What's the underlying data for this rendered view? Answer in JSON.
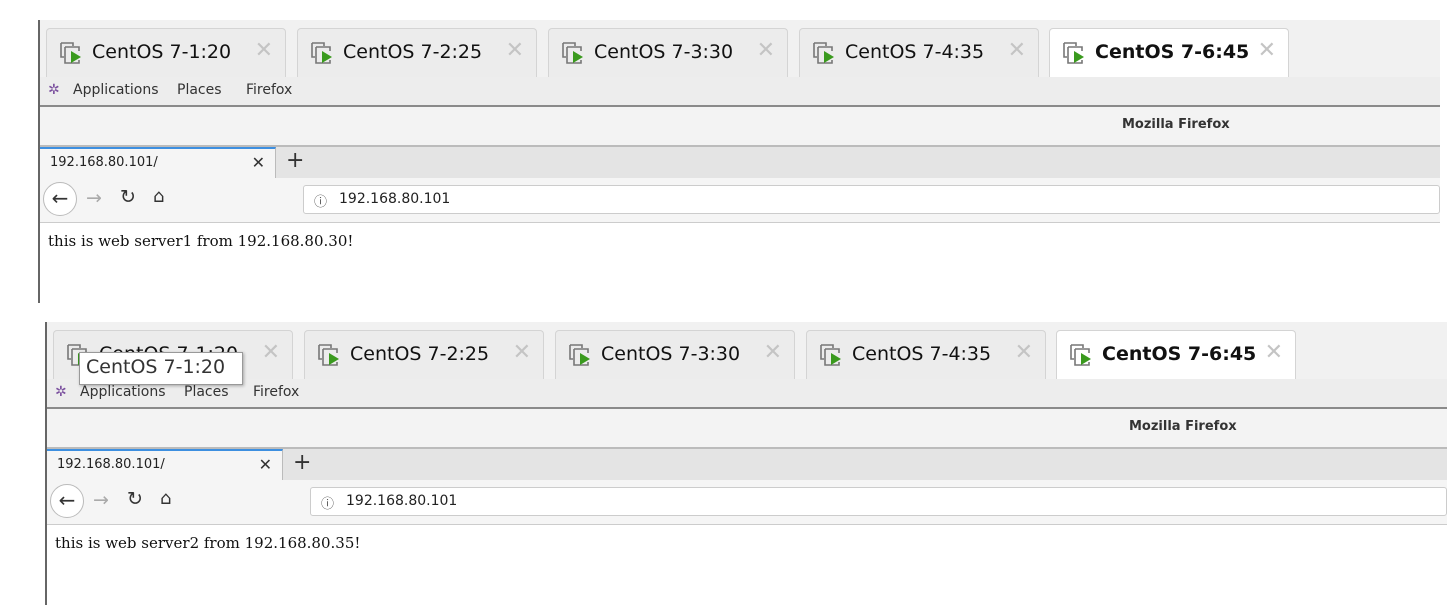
{
  "vm_tabs": [
    "CentOS 7-1:20",
    "CentOS 7-2:25",
    "CentOS 7-3:30",
    "CentOS 7-4:35",
    "CentOS 7-6:45"
  ],
  "active_vm_tab": "CentOS 7-6:45",
  "menu": {
    "applications": "Applications",
    "places": "Places",
    "firefox": "Firefox"
  },
  "window_title": "Mozilla Firefox",
  "icons": {
    "vm": "vm-play-icon",
    "close": "close-icon",
    "back": "back-arrow-icon",
    "forward": "forward-arrow-icon",
    "reload": "reload-icon",
    "home": "home-icon",
    "info": "info-icon",
    "new_tab": "plus-icon"
  },
  "accent_color": "#3d8fe0",
  "tooltip": "CentOS 7-1:20",
  "panels": [
    {
      "tab_title": "192.168.80.101/",
      "url": "192.168.80.101",
      "message": "this is web server1 from 192.168.80.30!"
    },
    {
      "tab_title": "192.168.80.101/",
      "url": "192.168.80.101",
      "message": "this is web server2 from 192.168.80.35!"
    }
  ],
  "glyphs": {
    "close": "✕",
    "plus": "+",
    "back": "←",
    "forward": "→",
    "reload": "↻",
    "home": "⌂",
    "info": "ⓘ"
  }
}
